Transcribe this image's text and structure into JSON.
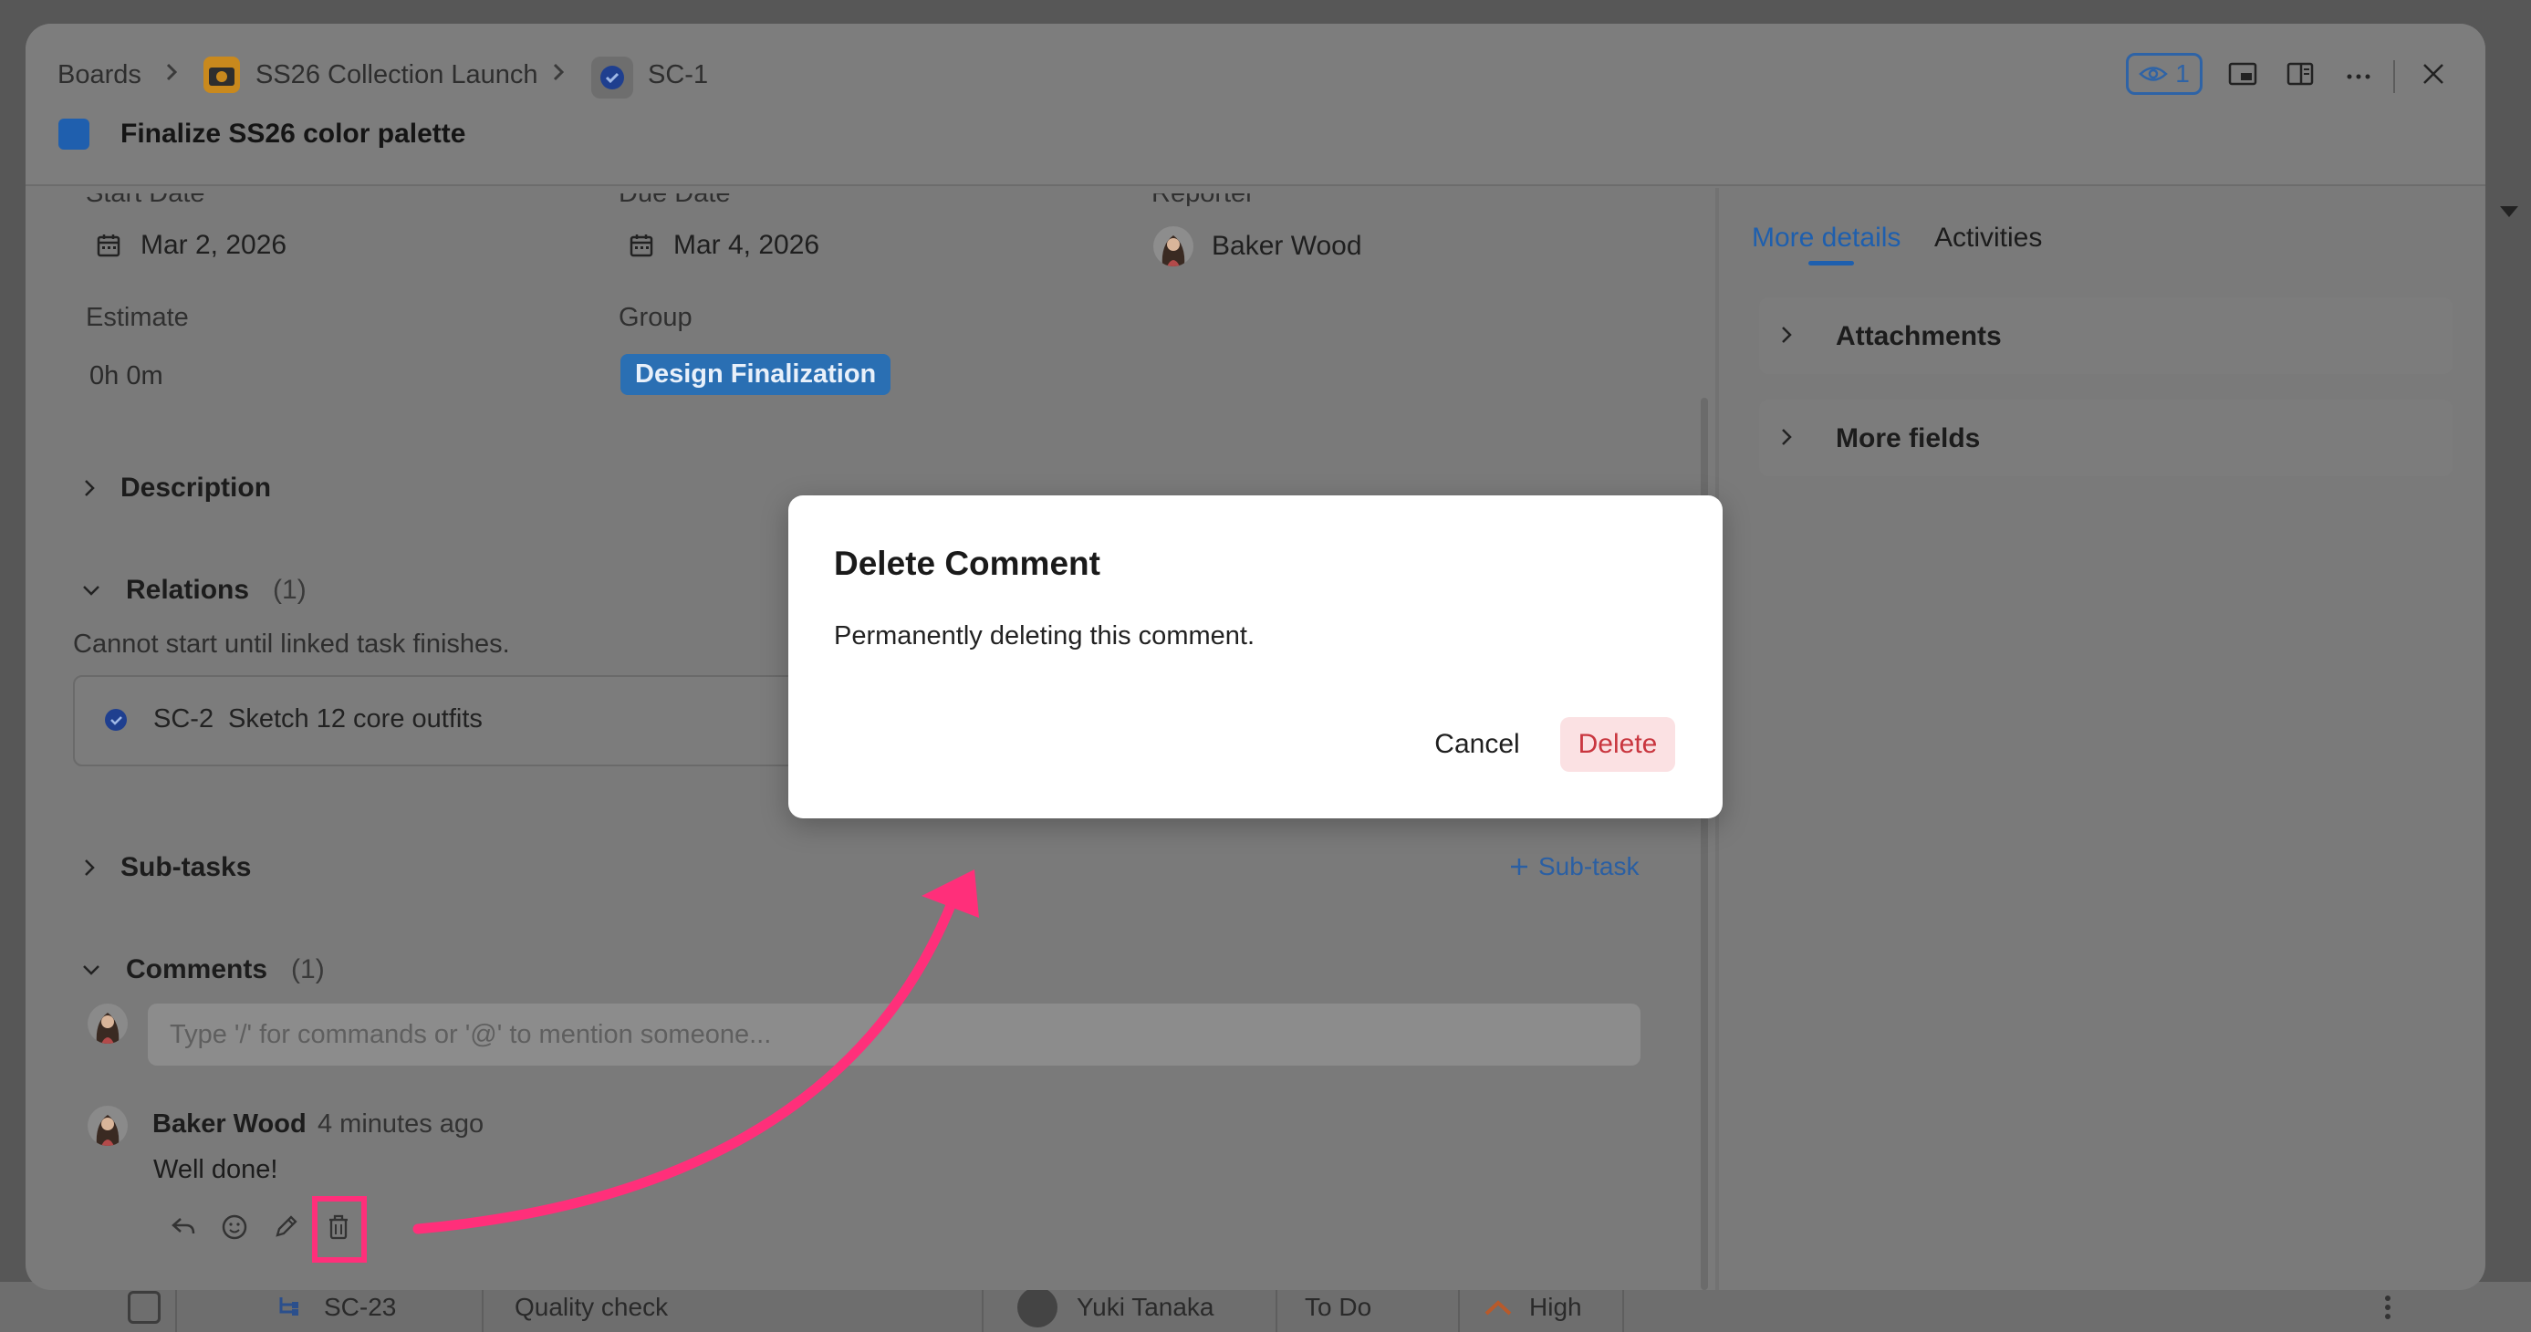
{
  "breadcrumb": {
    "boards": "Boards",
    "project": "SS26 Collection Launch",
    "task_id": "SC-1"
  },
  "task": {
    "title": "Finalize SS26 color palette",
    "accent": "#1e6fd0"
  },
  "toolbar": {
    "watchers_count": "1"
  },
  "fields": {
    "start_date_label": "Start Date",
    "start_date": "Mar 2, 2026",
    "due_date_label": "Due Date",
    "due_date": "Mar 4, 2026",
    "reporter_label": "Reporter",
    "reporter": "Baker Wood",
    "estimate_label": "Estimate",
    "estimate": "0h 0m",
    "group_label": "Group",
    "group": "Design Finalization"
  },
  "sections": {
    "description": "Description",
    "relations": "Relations",
    "relations_count": "(1)",
    "relations_note": "Cannot start until linked task finishes.",
    "relation_item_id": "SC-2",
    "relation_item_title": "Sketch 12 core outfits",
    "subtasks": "Sub-tasks",
    "add_subtask": "Sub-task",
    "comments": "Comments",
    "comments_count": "(1)"
  },
  "comment_box": {
    "placeholder": "Type '/' for commands or '@' to mention someone..."
  },
  "comment": {
    "author": "Baker Wood",
    "time": "4 minutes ago",
    "text": "Well done!"
  },
  "right_panel": {
    "tab_more_details": "More details",
    "tab_activities": "Activities",
    "attachments": "Attachments",
    "more_fields": "More fields"
  },
  "modal": {
    "title": "Delete Comment",
    "body": "Permanently deleting this comment.",
    "cancel": "Cancel",
    "delete": "Delete"
  },
  "background_row": {
    "id": "SC-23",
    "title": "Quality check",
    "assignee": "Yuki Tanaka",
    "status": "To Do",
    "priority": "High"
  },
  "colors": {
    "link_blue": "#1e6fd0",
    "delete_red": "#c9363f",
    "highlight_pink": "#ff2f7a"
  }
}
